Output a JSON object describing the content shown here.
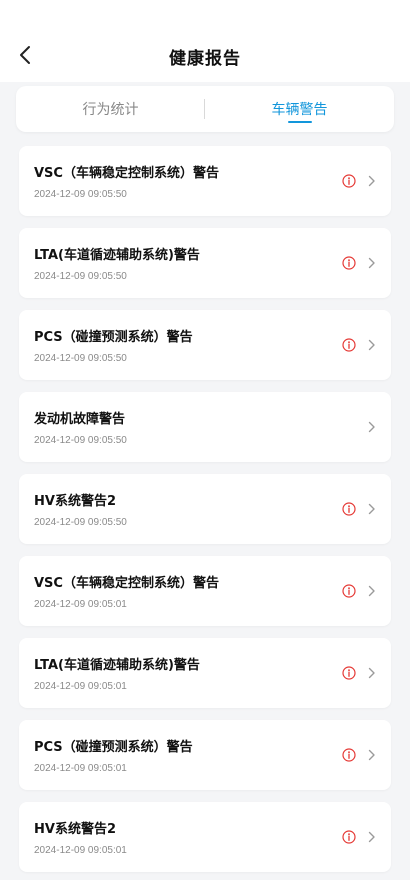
{
  "header": {
    "title": "健康报告"
  },
  "tabs": [
    {
      "label": "行为统计"
    },
    {
      "label": "车辆警告"
    }
  ],
  "active_tab": "车辆警告",
  "colors": {
    "accent": "#1296db",
    "warning_icon": "#e53935"
  },
  "icons": {
    "back": "chevron-left-icon",
    "warning": "info-circle-icon",
    "row_arrow": "chevron-right-icon"
  },
  "warnings": [
    {
      "title": "VSC（车辆稳定控制系统）警告",
      "time": "2024-12-09 09:05:50",
      "has_icon": true
    },
    {
      "title": "LTA(车道循迹辅助系统)警告",
      "time": "2024-12-09 09:05:50",
      "has_icon": true
    },
    {
      "title": "PCS（碰撞预测系统）警告",
      "time": "2024-12-09 09:05:50",
      "has_icon": true
    },
    {
      "title": "发动机故障警告",
      "time": "2024-12-09 09:05:50",
      "has_icon": false
    },
    {
      "title": "HV系统警告2",
      "time": "2024-12-09 09:05:50",
      "has_icon": true
    },
    {
      "title": "VSC（车辆稳定控制系统）警告",
      "time": "2024-12-09 09:05:01",
      "has_icon": true
    },
    {
      "title": "LTA(车道循迹辅助系统)警告",
      "time": "2024-12-09 09:05:01",
      "has_icon": true
    },
    {
      "title": "PCS（碰撞预测系统）警告",
      "time": "2024-12-09 09:05:01",
      "has_icon": true
    },
    {
      "title": "HV系统警告2",
      "time": "2024-12-09 09:05:01",
      "has_icon": true
    }
  ]
}
